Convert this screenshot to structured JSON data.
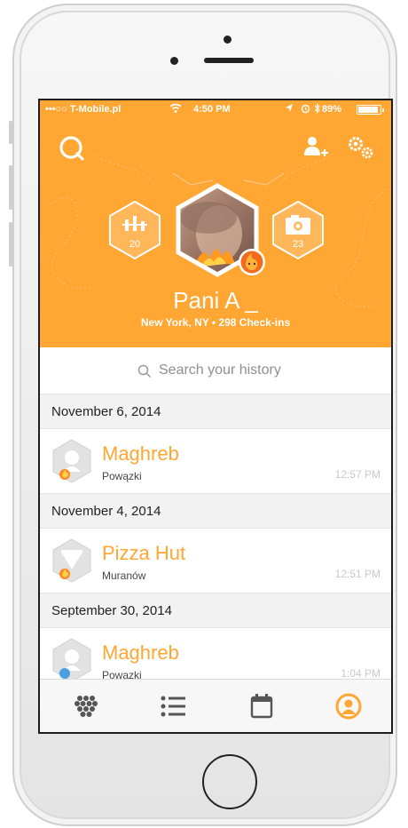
{
  "status_bar": {
    "carrier": "•••○○ T-Mobile.pl",
    "time": "4:50 PM",
    "battery": "89%"
  },
  "profile": {
    "name": "Pani A _",
    "meta": "New York, NY • 298 Check-ins",
    "left_hex_count": "20",
    "right_hex_count": "23"
  },
  "search": {
    "placeholder": "Search your history"
  },
  "history": [
    {
      "date": "November 6, 2014",
      "checkins": [
        {
          "venue": "Maghreb",
          "neighborhood": "Powązki",
          "time": "12:57 PM"
        }
      ]
    },
    {
      "date": "November 4, 2014",
      "checkins": [
        {
          "venue": "Pizza Hut",
          "neighborhood": "Muranów",
          "time": "12:51 PM"
        }
      ]
    },
    {
      "date": "September 30, 2014",
      "checkins": [
        {
          "venue": "Maghreb",
          "neighborhood": "Powązki",
          "time": "1:04 PM"
        }
      ]
    }
  ],
  "tabs": [
    "categories-icon",
    "list-icon",
    "calendar-icon",
    "profile-icon"
  ],
  "colors": {
    "accent": "#ffa633",
    "tab_active": "#ffa633",
    "tab_inactive": "#555555"
  }
}
